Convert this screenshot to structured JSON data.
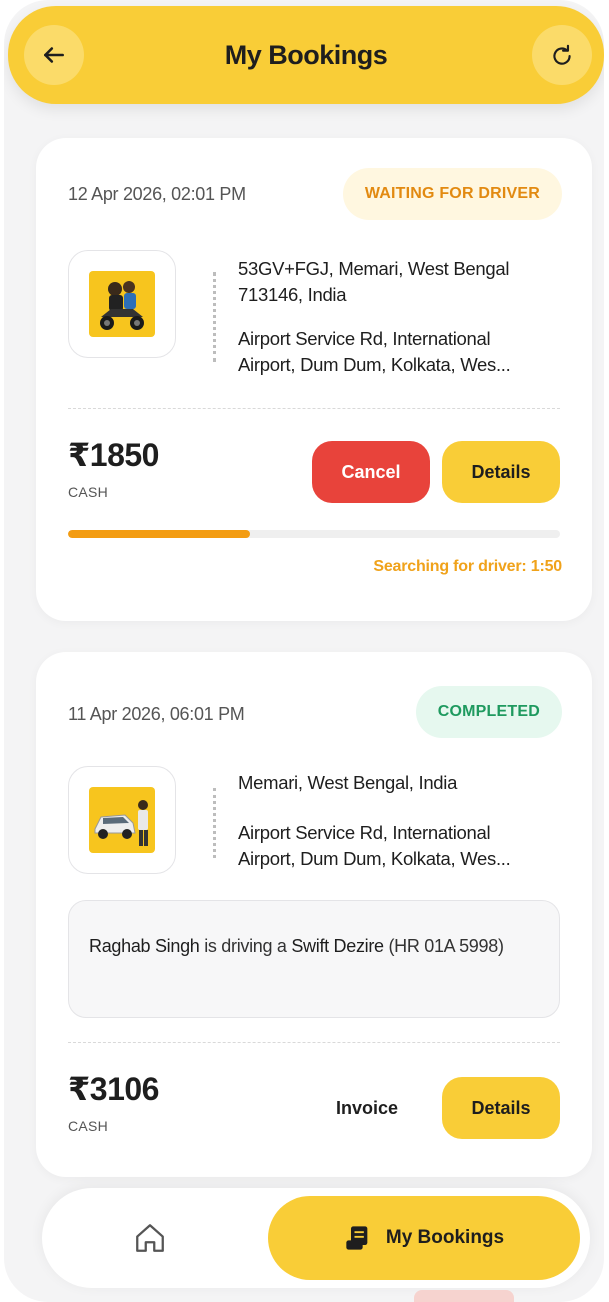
{
  "header": {
    "title": "My Bookings",
    "back_icon": "arrow-left-icon",
    "refresh_icon": "refresh-icon"
  },
  "bookings": [
    {
      "date": "12 Apr 2026, 02:01 PM",
      "status": "WAITING FOR DRIVER",
      "status_color": "#e28a11",
      "vehicle_icon": "bike-rider-icon",
      "pickup": "53GV+FGJ, Memari, West Bengal 713146, India",
      "dropoff_line1": "Airport Service Rd, International",
      "dropoff_line2": "Airport, Dum Dum, Kolkata, Wes...",
      "price": "₹1850",
      "payment": "CASH",
      "cancel_label": "Cancel",
      "details_label": "Details",
      "progress_fraction": 0.37,
      "searching_text": "Searching for driver: 1:50"
    },
    {
      "date": "11 Apr 2026, 06:01 PM",
      "status": "COMPLETED",
      "status_color": "#1f9a5f",
      "vehicle_icon": "car-icon",
      "pickup": "Memari, West Bengal, India",
      "dropoff_line1": "Airport Service Rd, International",
      "dropoff_line2": "Airport, Dum Dum, Kolkata, Wes...",
      "driver_name": "Raghab Singh",
      "driver_mid": " is driving a ",
      "vehicle_model": "Swift Dezire",
      "plate": " (HR 01A 5998)",
      "price": "₹3106",
      "payment": "CASH",
      "invoice_label": "Invoice",
      "details_label": "Details"
    }
  ],
  "nav": {
    "home_icon": "home-icon",
    "bookings_icon": "receipt-icon",
    "bookings_label": "My Bookings"
  },
  "colors": {
    "accent": "#f9cd37",
    "danger": "#e8433b",
    "progress": "#f39c12"
  }
}
